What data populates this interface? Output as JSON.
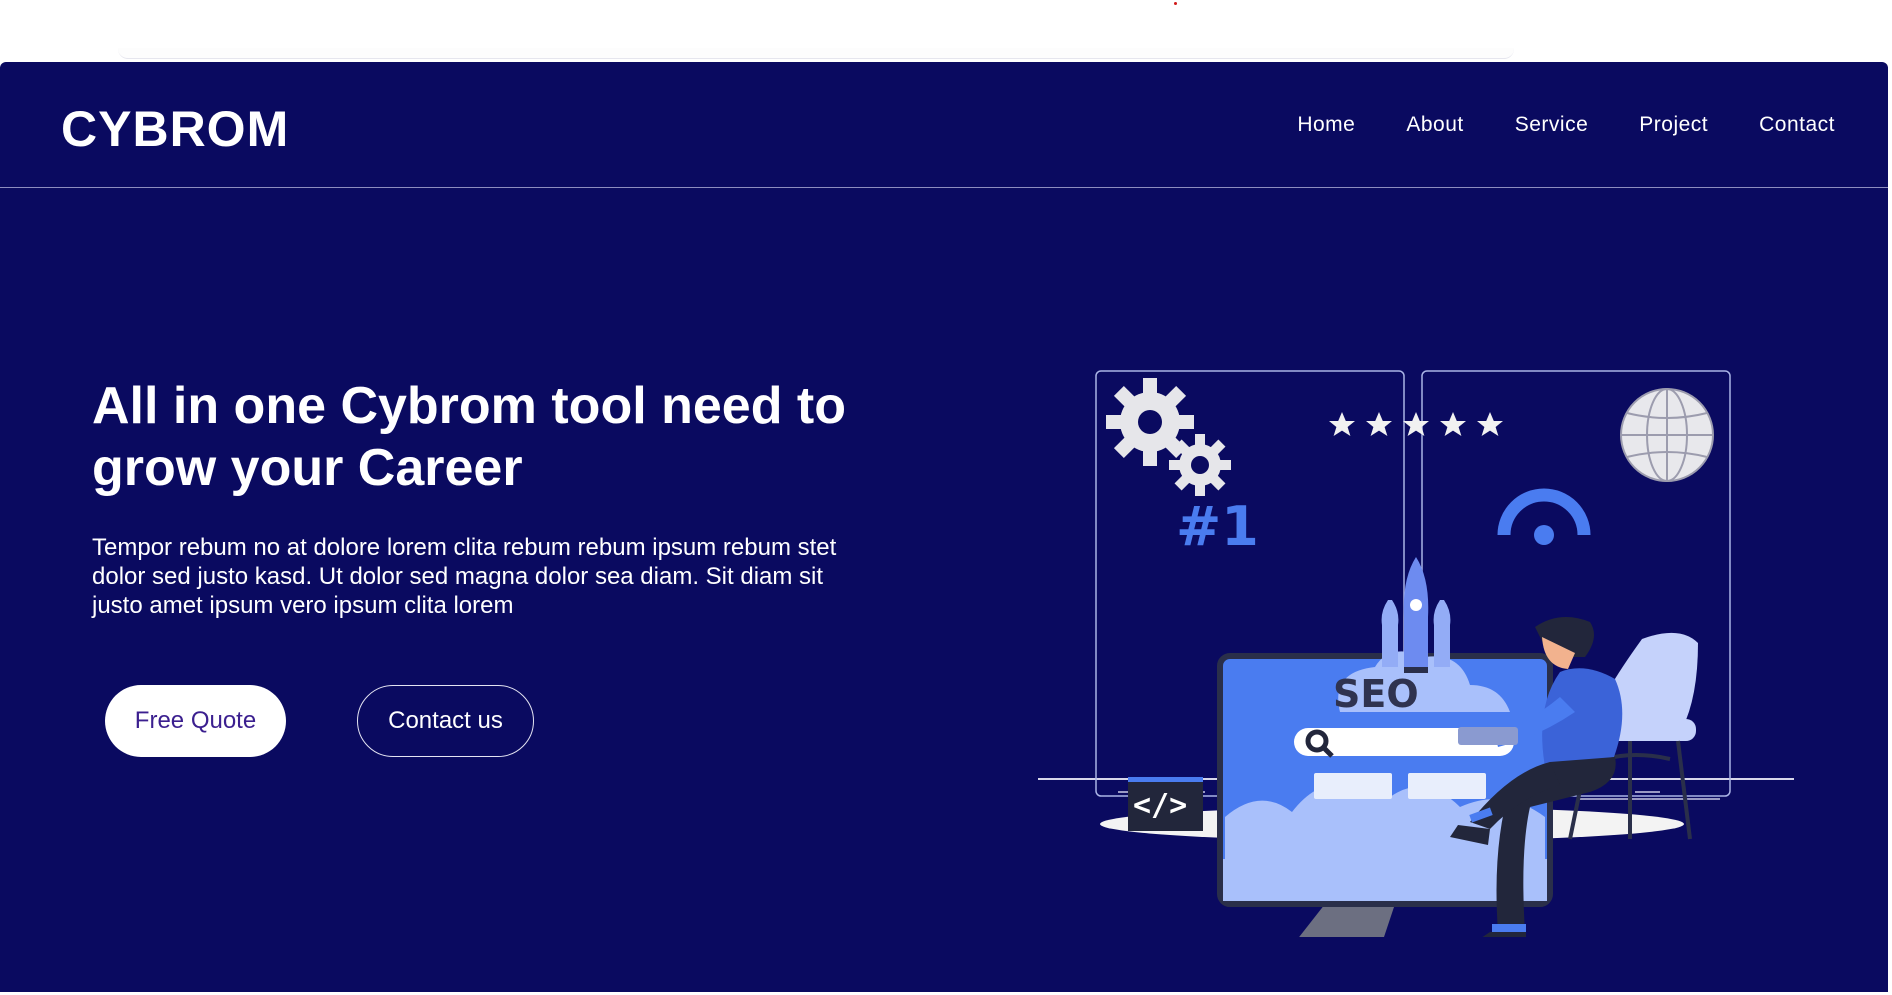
{
  "brand": {
    "name": "CYBROM"
  },
  "nav": {
    "items": [
      {
        "label": "Home"
      },
      {
        "label": "About"
      },
      {
        "label": "Service"
      },
      {
        "label": "Project"
      },
      {
        "label": "Contact"
      }
    ]
  },
  "hero": {
    "title": "All in one Cybrom tool need to grow your Career",
    "text": "Tempor rebum no at dolore lorem clita rebum rebum ipsum rebum stet dolor sed justo kasd. Ut dolor sed magna dolor sea diam. Sit diam sit justo amet ipsum vero ipsum clita lorem",
    "buttons": {
      "quote": "Free Quote",
      "contact": "Contact us"
    }
  },
  "illustration": {
    "seo_label": "SEO",
    "rank_label": "#1",
    "code_label": "</>",
    "rating_stars": 5
  },
  "colors": {
    "page_bg": "#0a0a60",
    "accent_blue": "#4a7cf0",
    "light_blue": "#a9c0fb",
    "button_text": "#3b1f8f"
  }
}
